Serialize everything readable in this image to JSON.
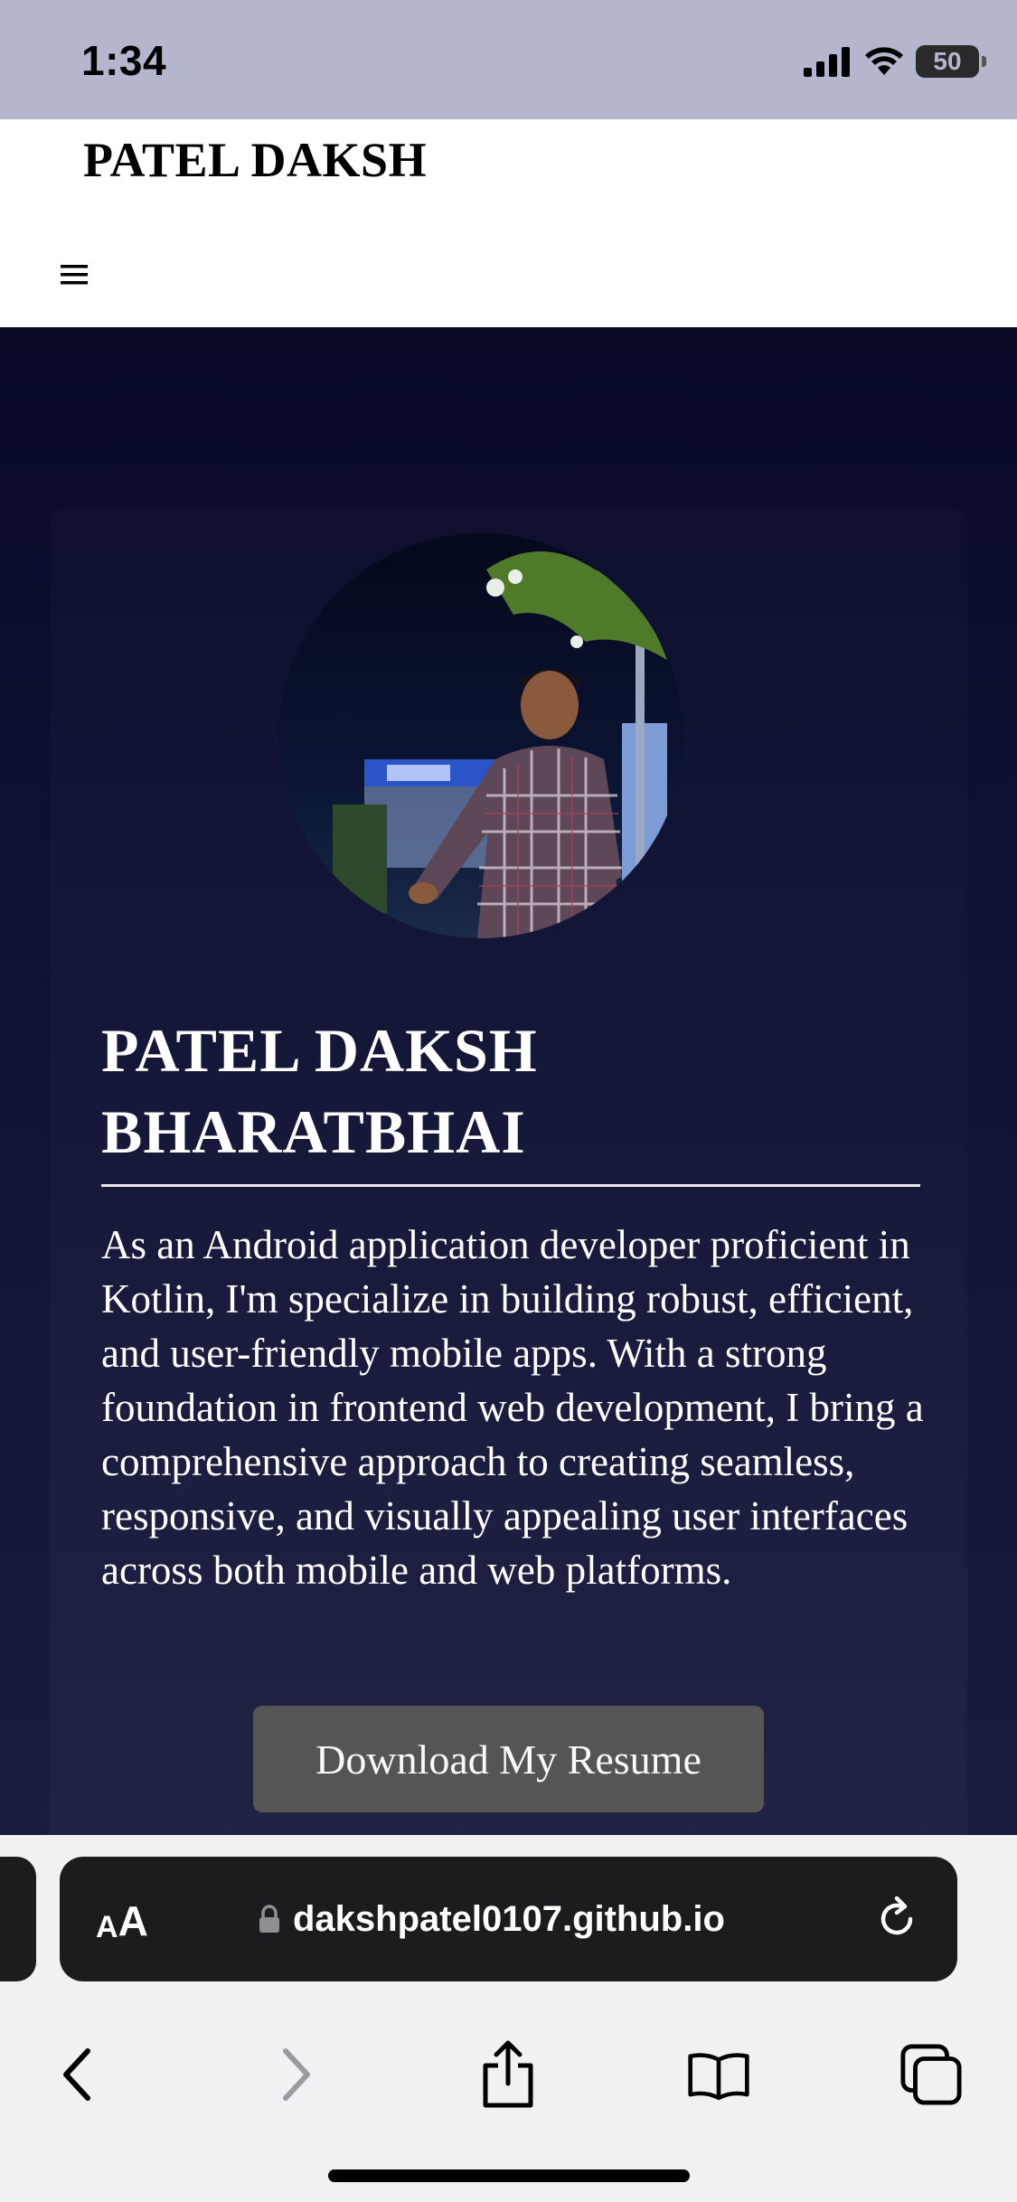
{
  "status_bar": {
    "time": "1:34",
    "battery": "50"
  },
  "site_header": {
    "brand": "PATEL DAKSH",
    "menu_icon": "hamburger-menu-icon"
  },
  "hero": {
    "name_line1": "PATEL DAKSH",
    "name_line2": "BHARATBHAI",
    "bio": "As an Android application developer proficient in Kotlin, I'm specialize in building robust, efficient, and user-friendly mobile apps. With a strong foundation in frontend web development, I bring a comprehensive approach to creating seamless, responsive, and visually appealing user interfaces across both mobile and web platforms.",
    "resume_button": "Download My Resume"
  },
  "browser": {
    "aa_small": "A",
    "aa_large": "A",
    "url": "dakshpatel0107.github.io",
    "toolbar_icons": [
      "back-icon",
      "forward-icon",
      "share-icon",
      "bookmarks-icon",
      "tabs-icon"
    ]
  },
  "colors": {
    "status_bar_bg": "#b4b6ce",
    "hero_bg_top": "#080a26",
    "hero_bg_bottom": "#191c3d",
    "button_bg": "#555556",
    "url_pill_bg": "#1c1c1e"
  }
}
